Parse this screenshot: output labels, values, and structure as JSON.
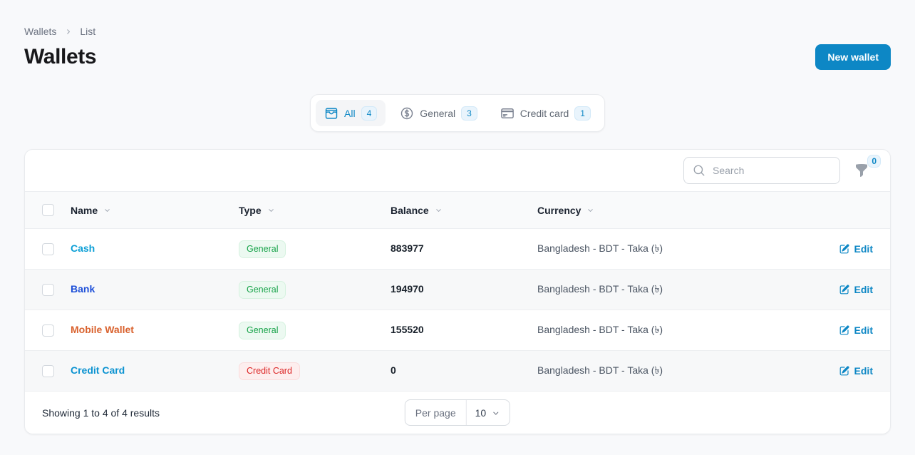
{
  "colors": {
    "primary": "#0d87c5",
    "success": "#18a34a",
    "danger": "#dc2626"
  },
  "breadcrumb": {
    "root": "Wallets",
    "current": "List"
  },
  "header": {
    "title": "Wallets",
    "new_wallet_button": "New wallet"
  },
  "tabs": {
    "items": [
      {
        "label": "All",
        "count": "4",
        "icon": "wallet-icon",
        "active": true
      },
      {
        "label": "General",
        "count": "3",
        "icon": "currency-dollar-icon",
        "active": false
      },
      {
        "label": "Credit card",
        "count": "1",
        "icon": "credit-card-icon",
        "active": false
      }
    ]
  },
  "toolbar": {
    "search_placeholder": "Search",
    "filter_badge_count": "0"
  },
  "table": {
    "columns": [
      {
        "label": "Name"
      },
      {
        "label": "Type"
      },
      {
        "label": "Balance"
      },
      {
        "label": "Currency"
      }
    ],
    "rows": [
      {
        "name": "Cash",
        "name_color": "#0c9fd6",
        "type_label": "General",
        "type_variant": "success",
        "balance": "883977",
        "currency": "Bangladesh - BDT - Taka (৳)",
        "edit_label": "Edit"
      },
      {
        "name": "Bank",
        "name_color": "#1d4fd8",
        "type_label": "General",
        "type_variant": "success",
        "balance": "194970",
        "currency": "Bangladesh - BDT - Taka (৳)",
        "edit_label": "Edit"
      },
      {
        "name": "Mobile Wallet",
        "name_color": "#d9622e",
        "type_label": "General",
        "type_variant": "success",
        "balance": "155520",
        "currency": "Bangladesh - BDT - Taka (৳)",
        "edit_label": "Edit"
      },
      {
        "name": "Credit Card",
        "name_color": "#0c93d1",
        "type_label": "Credit Card",
        "type_variant": "danger",
        "balance": "0",
        "currency": "Bangladesh - BDT - Taka (৳)",
        "edit_label": "Edit"
      }
    ]
  },
  "pagination": {
    "summary": "Showing 1 to 4 of 4 results",
    "per_page_label": "Per page",
    "per_page_value": "10"
  }
}
